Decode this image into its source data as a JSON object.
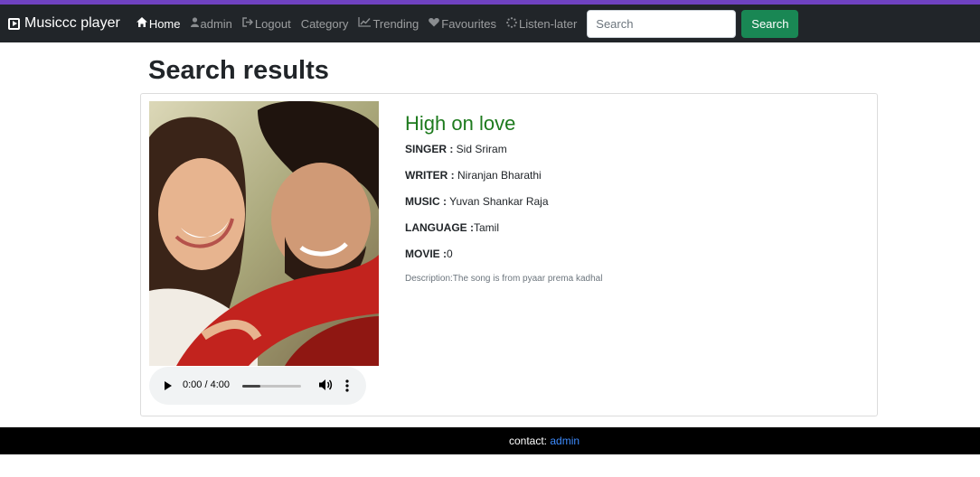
{
  "navbar": {
    "brand": "Musiccc player",
    "items": [
      {
        "label": "Home",
        "icon": "home-icon",
        "active": true
      },
      {
        "label": "admin",
        "icon": "user-icon"
      },
      {
        "label": "Logout",
        "icon": "logout-icon"
      },
      {
        "label": "Category",
        "icon": ""
      },
      {
        "label": "Trending",
        "icon": "trending-icon"
      },
      {
        "label": "Favourites",
        "icon": "heart-icon"
      },
      {
        "label": "Listen-later",
        "icon": "spinner-icon"
      }
    ],
    "search_placeholder": "Search",
    "search_button": "Search"
  },
  "page": {
    "title": "Search results"
  },
  "result": {
    "title": "High on love",
    "singer_label": "SINGER :",
    "singer": " Sid Sriram",
    "writer_label": "WRITER :",
    "writer": " Niranjan Bharathi",
    "music_label": "MUSIC :",
    "music": " Yuvan Shankar Raja",
    "language_label": "LANGUAGE :",
    "language": "Tamil",
    "movie_label": "MOVIE :",
    "movie": "0",
    "description": "Description:The song is from pyaar prema kadhal",
    "audio": {
      "time": "0:00 / 4:00",
      "progress": 0.3
    }
  },
  "footer": {
    "contact_label": "contact:",
    "contact_link": "admin"
  },
  "colors": {
    "accent": "#6f42c1",
    "navbar": "#212529",
    "search_button": "#198754",
    "song_title": "#1d7a1d",
    "footer": "#000000",
    "link": "#3d8bfd"
  }
}
